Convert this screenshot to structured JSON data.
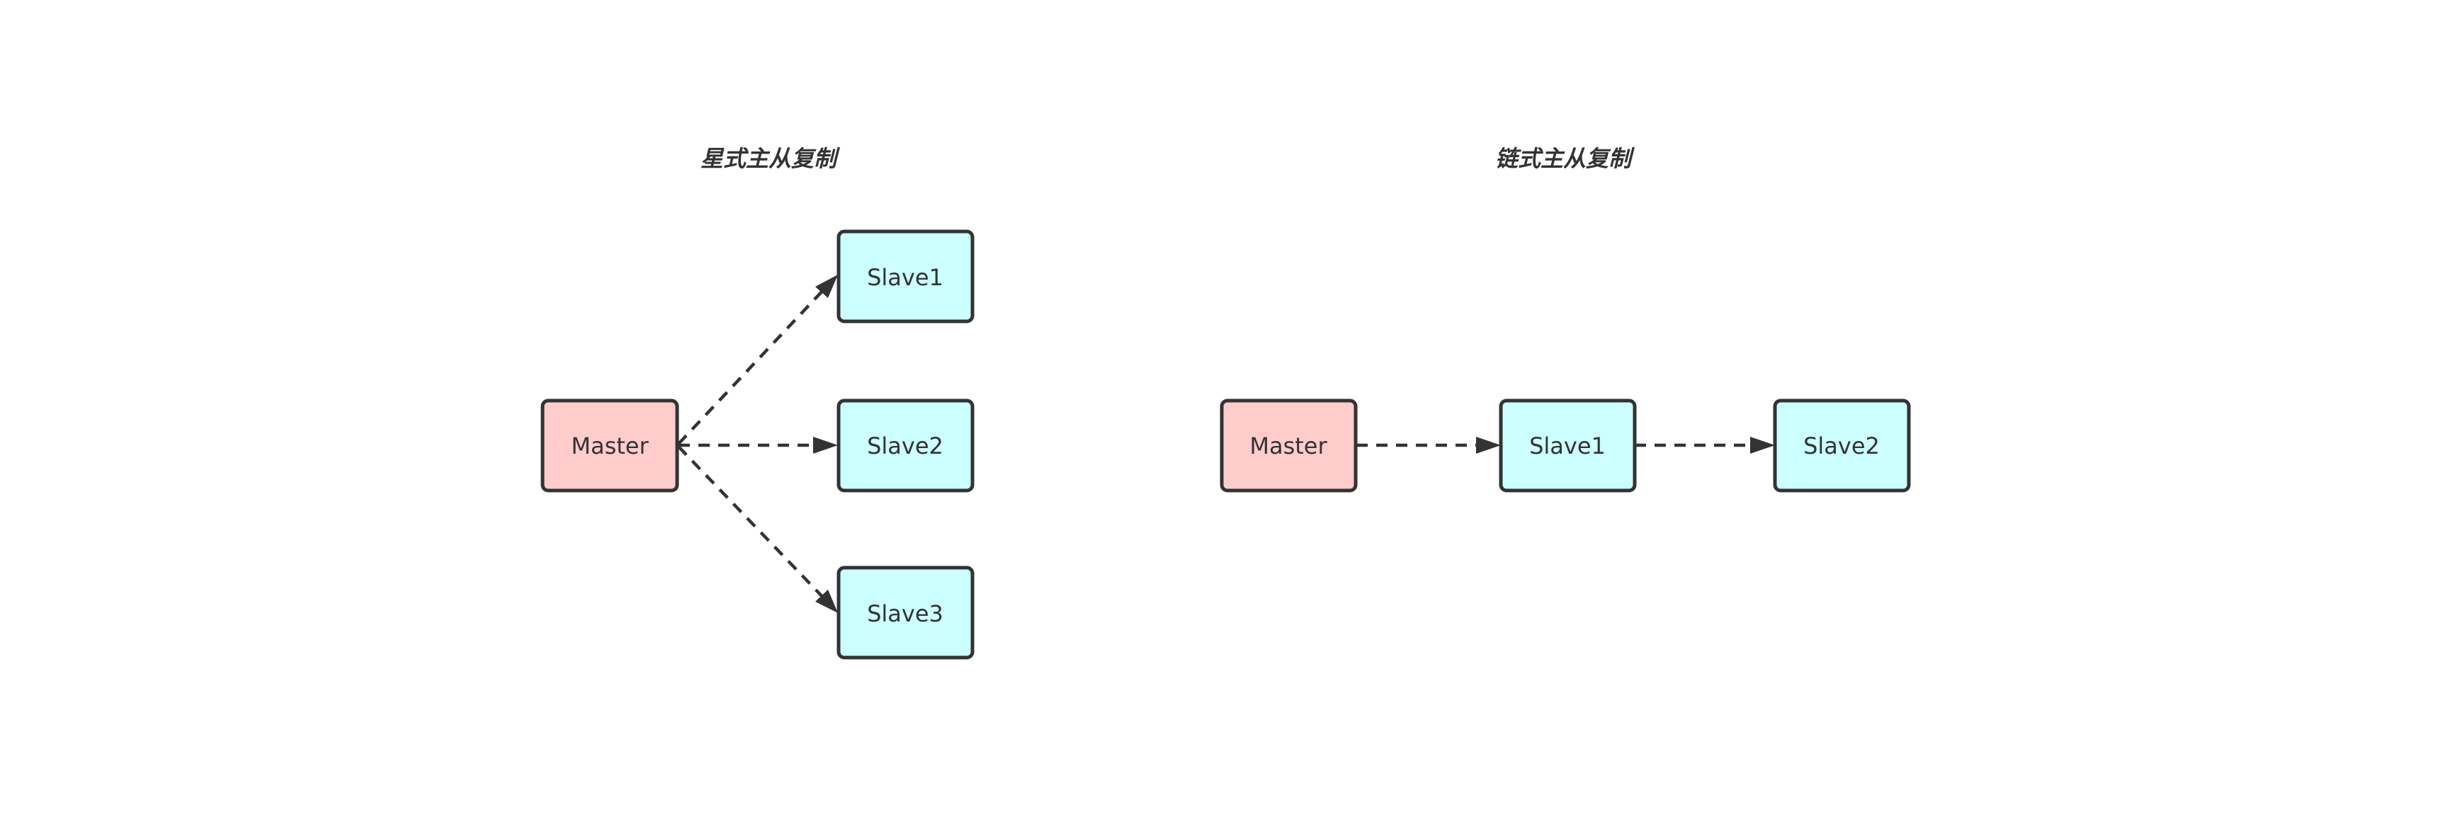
{
  "diagrams": [
    {
      "title": "星式主从复制",
      "nodes": [
        {
          "label": "Master",
          "role": "master"
        },
        {
          "label": "Slave1",
          "role": "slave"
        },
        {
          "label": "Slave2",
          "role": "slave"
        },
        {
          "label": "Slave3",
          "role": "slave"
        }
      ],
      "edges": [
        {
          "from": "Master",
          "to": "Slave1",
          "style": "dashed-arrow"
        },
        {
          "from": "Master",
          "to": "Slave2",
          "style": "dashed-arrow"
        },
        {
          "from": "Master",
          "to": "Slave3",
          "style": "dashed-arrow"
        }
      ]
    },
    {
      "title": "链式主从复制",
      "nodes": [
        {
          "label": "Master",
          "role": "master"
        },
        {
          "label": "Slave1",
          "role": "slave"
        },
        {
          "label": "Slave2",
          "role": "slave"
        }
      ],
      "edges": [
        {
          "from": "Master",
          "to": "Slave1",
          "style": "dashed-arrow"
        },
        {
          "from": "Slave1",
          "to": "Slave2",
          "style": "dashed-arrow"
        }
      ]
    }
  ],
  "colors": {
    "master_fill": "#ffcccc",
    "slave_fill": "#ccffff",
    "stroke": "#333333",
    "text": "#333333",
    "background": "#ffffff"
  }
}
